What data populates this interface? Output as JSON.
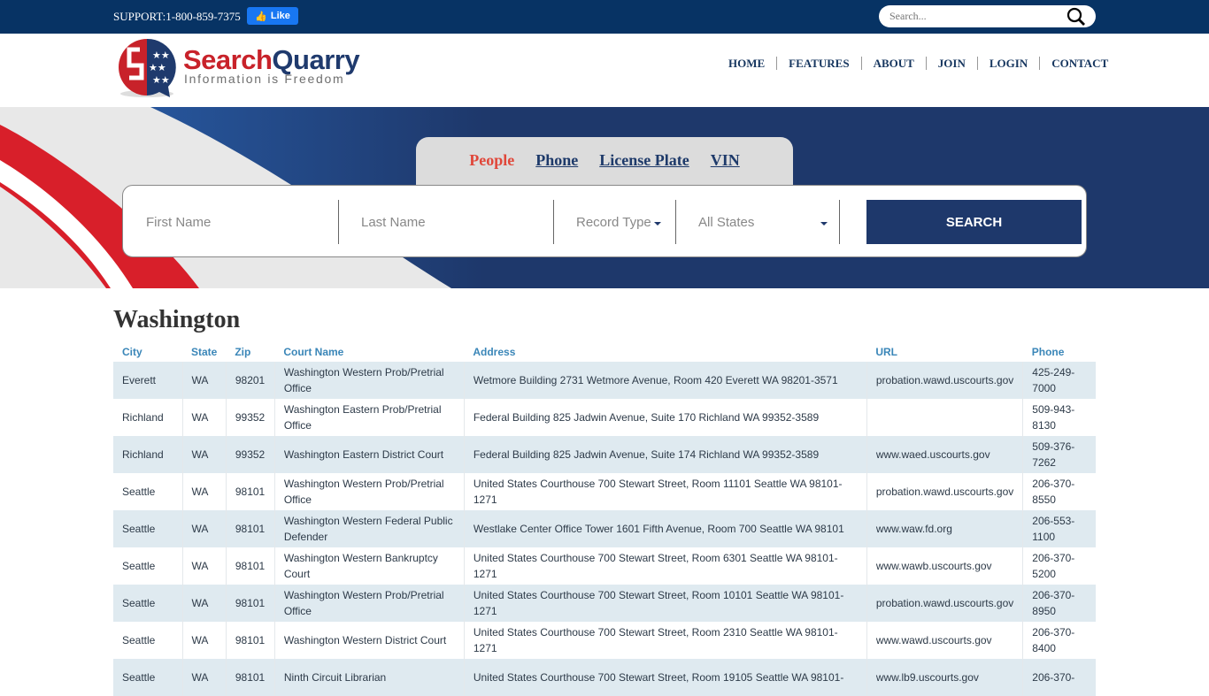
{
  "topbar": {
    "support": "SUPPORT:1-800-859-7375",
    "like_label": "Like",
    "search_placeholder": "Search..."
  },
  "logo": {
    "name_part1": "Search",
    "name_part2": "Quarry",
    "tagline": "Information is Freedom"
  },
  "nav": [
    "HOME",
    "FEATURES",
    "ABOUT",
    "JOIN",
    "LOGIN",
    "CONTACT"
  ],
  "search": {
    "tabs": [
      {
        "label": "People",
        "active": true
      },
      {
        "label": "Phone",
        "active": false
      },
      {
        "label": "License Plate",
        "active": false
      },
      {
        "label": "VIN",
        "active": false
      }
    ],
    "first_name_placeholder": "First Name",
    "last_name_placeholder": "Last Name",
    "record_type": "Record Type",
    "state": "All States",
    "button": "SEARCH"
  },
  "colors": {
    "navy": "#1e386b",
    "topbar": "#073364",
    "red": "#c8222a",
    "active_tab": "#e0473a",
    "header_link": "#3a86b8",
    "row_alt": "#dfeaf0"
  },
  "main": {
    "title": "Washington",
    "columns": [
      "City",
      "State",
      "Zip",
      "Court Name",
      "Address",
      "URL",
      "Phone"
    ],
    "rows": [
      [
        "Everett",
        "WA",
        "98201",
        "Washington Western Prob/Pretrial Office",
        "Wetmore Building 2731 Wetmore Avenue, Room 420 Everett WA 98201-3571",
        "probation.wawd.uscourts.gov",
        "425-249-7000"
      ],
      [
        "Richland",
        "WA",
        "99352",
        "Washington Eastern Prob/Pretrial Office",
        "Federal Building 825 Jadwin Avenue, Suite 170 Richland WA 99352-3589",
        "",
        "509-943-8130"
      ],
      [
        "Richland",
        "WA",
        "99352",
        "Washington Eastern District Court",
        "Federal Building 825 Jadwin Avenue, Suite 174 Richland WA 99352-3589",
        "www.waed.uscourts.gov",
        "509-376-7262"
      ],
      [
        "Seattle",
        "WA",
        "98101",
        "Washington Western Prob/Pretrial Office",
        "United States Courthouse 700 Stewart Street, Room 11101 Seattle WA 98101-1271",
        "probation.wawd.uscourts.gov",
        "206-370-8550"
      ],
      [
        "Seattle",
        "WA",
        "98101",
        "Washington Western Federal Public Defender",
        "Westlake Center Office Tower 1601 Fifth Avenue, Room 700 Seattle WA 98101",
        "www.waw.fd.org",
        "206-553-1100"
      ],
      [
        "Seattle",
        "WA",
        "98101",
        "Washington Western Bankruptcy Court",
        "United States Courthouse 700 Stewart Street, Room 6301 Seattle WA 98101-1271",
        "www.wawb.uscourts.gov",
        "206-370-5200"
      ],
      [
        "Seattle",
        "WA",
        "98101",
        "Washington Western Prob/Pretrial Office",
        "United States Courthouse 700 Stewart Street, Room 10101 Seattle WA 98101-1271",
        "probation.wawd.uscourts.gov",
        "206-370-8950"
      ],
      [
        "Seattle",
        "WA",
        "98101",
        "Washington Western District Court",
        "United States Courthouse 700 Stewart Street, Room 2310 Seattle WA 98101-1271",
        "www.wawd.uscourts.gov",
        "206-370-8400"
      ],
      [
        "Seattle",
        "WA",
        "98101",
        "Ninth Circuit Librarian",
        "United States Courthouse 700 Stewart Street, Room 19105 Seattle WA 98101-",
        "www.lb9.uscourts.gov",
        "206-370-"
      ]
    ]
  }
}
